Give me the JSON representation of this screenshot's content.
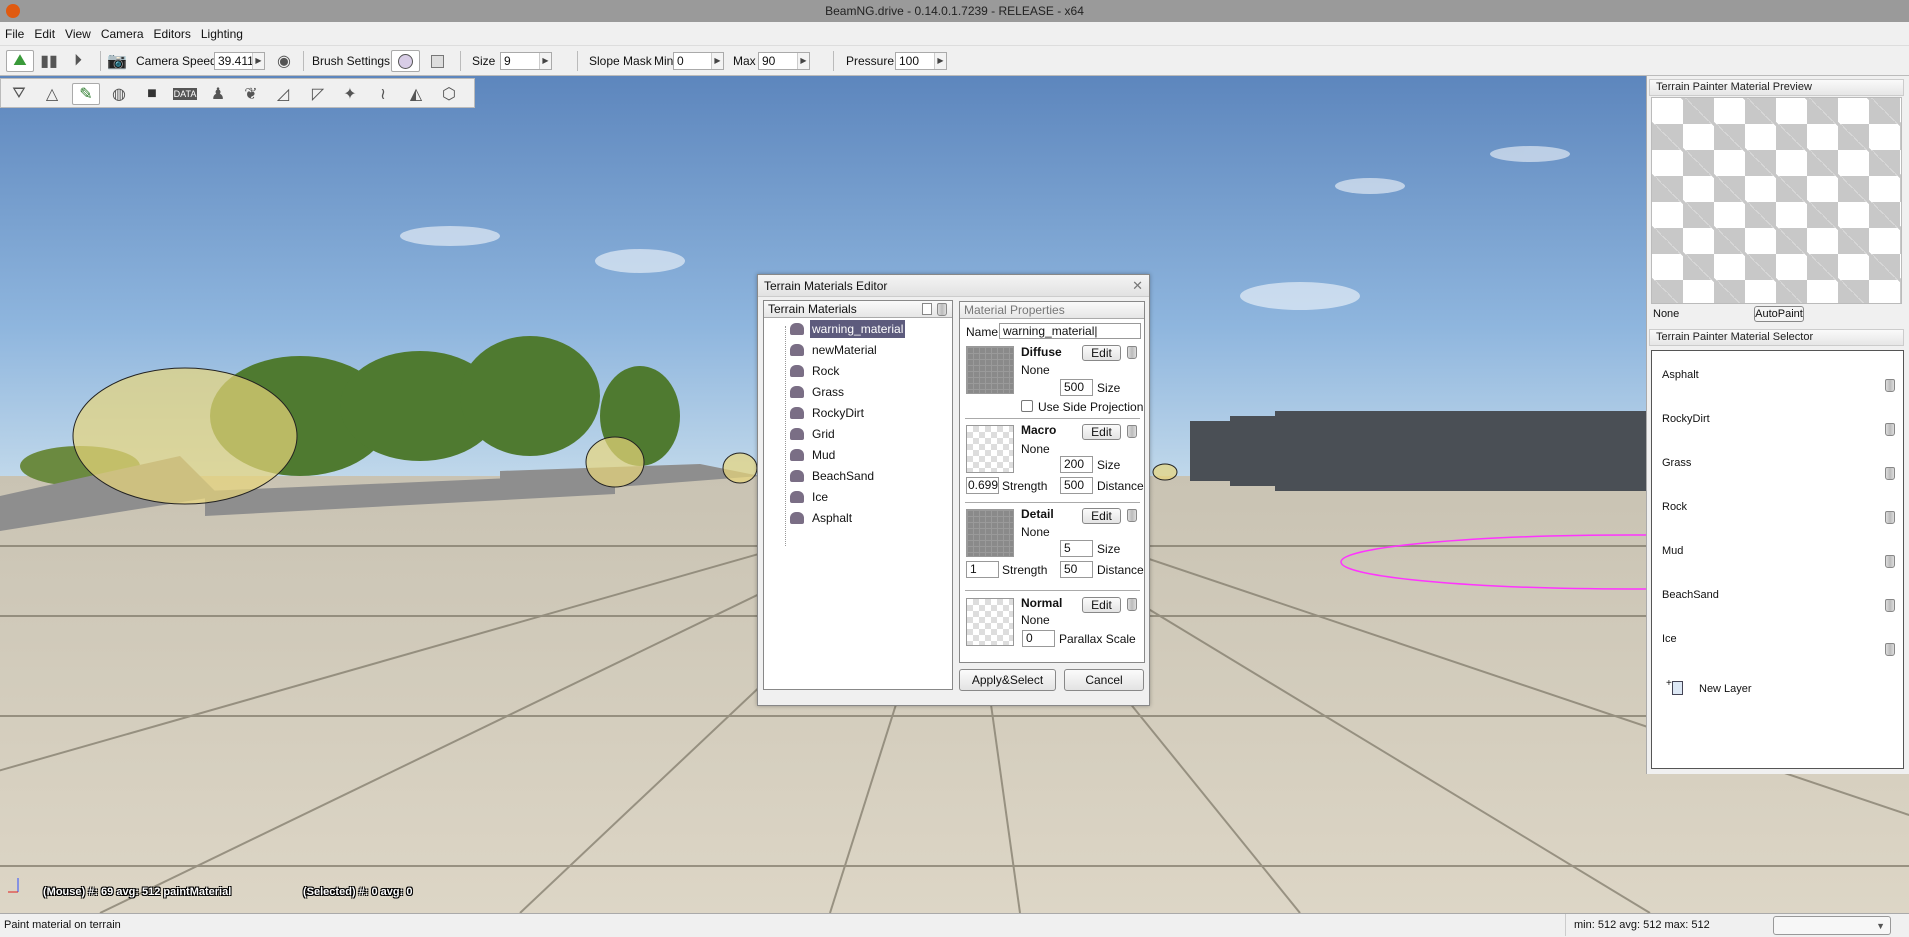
{
  "window": {
    "title": "BeamNG.drive - 0.14.0.1.7239 - RELEASE - x64"
  },
  "menu": [
    "File",
    "Edit",
    "View",
    "Camera",
    "Editors",
    "Lighting"
  ],
  "toolbar": {
    "camera_speed_label": "Camera Speed",
    "camera_speed_value": "39.411",
    "brush_settings_label": "Brush Settings",
    "size_label": "Size",
    "size_value": "9",
    "slope_mask_label": "Slope Mask",
    "min_label": "Min",
    "min_value": "0",
    "max_label": "Max",
    "max_value": "90",
    "pressure_label": "Pressure",
    "pressure_value": "100",
    "icons": [
      "world-editor-icon",
      "inspector-icon",
      "play-icon",
      "camera-icon",
      "eye-icon",
      "brush-circle-icon",
      "brush-square-icon"
    ]
  },
  "tools": [
    "terrain-edit-icon",
    "terrain-raise-icon",
    "terrain-paint-icon",
    "globe-icon",
    "box-icon",
    "data-icon",
    "joystick-icon",
    "leaf-icon",
    "road-icon",
    "river-icon",
    "forest-icon",
    "decal-icon",
    "mesh-road-icon",
    "shape-icon"
  ],
  "overlay": {
    "mouse_info": "(Mouse) #: 69  avg: 512 paintMaterial",
    "selected_info": "(Selected) #: 0  avg: 0"
  },
  "statusbar": {
    "message": "Paint material on terrain",
    "stats": "min: 512  avg: 512  max: 512",
    "dropdown_value": ""
  },
  "dialog": {
    "title": "Terrain Materials Editor",
    "materials_header": "Terrain Materials",
    "materials": [
      "warning_material",
      "newMaterial",
      "Rock",
      "Grass",
      "RockyDirt",
      "Grid",
      "Mud",
      "BeachSand",
      "Ice",
      "Asphalt"
    ],
    "selected_material": "warning_material",
    "properties_header": "Material Properties",
    "name_label": "Name",
    "name_value": "warning_material",
    "edit_label": "Edit",
    "none_label": "None",
    "size_label": "Size",
    "strength_label": "Strength",
    "distance_label": "Distance",
    "diffuse": {
      "title": "Diffuse",
      "size": "500",
      "side_projection_label": "Use Side Projection",
      "side_projection": false
    },
    "macro": {
      "title": "Macro",
      "size": "200",
      "strength": "0.6999",
      "distance": "500"
    },
    "detail": {
      "title": "Detail",
      "size": "5",
      "strength": "1",
      "distance": "50"
    },
    "normal": {
      "title": "Normal",
      "parallax": "0",
      "parallax_label": "Parallax Scale"
    },
    "apply_label": "Apply&Select",
    "cancel_label": "Cancel"
  },
  "preview": {
    "title": "Terrain Painter Material Preview",
    "material": "None",
    "autopaint_label": "AutoPaint"
  },
  "selector": {
    "title": "Terrain Painter Material Selector",
    "items": [
      "Asphalt",
      "RockyDirt",
      "Grass",
      "Rock",
      "Mud",
      "BeachSand",
      "Ice"
    ],
    "new_layer_label": "New Layer"
  },
  "colors": {
    "selection": "#5d5b7d",
    "brush_ring": "#ff33ff",
    "sky": "#6e97c9",
    "ground": "#d6cfbf"
  }
}
